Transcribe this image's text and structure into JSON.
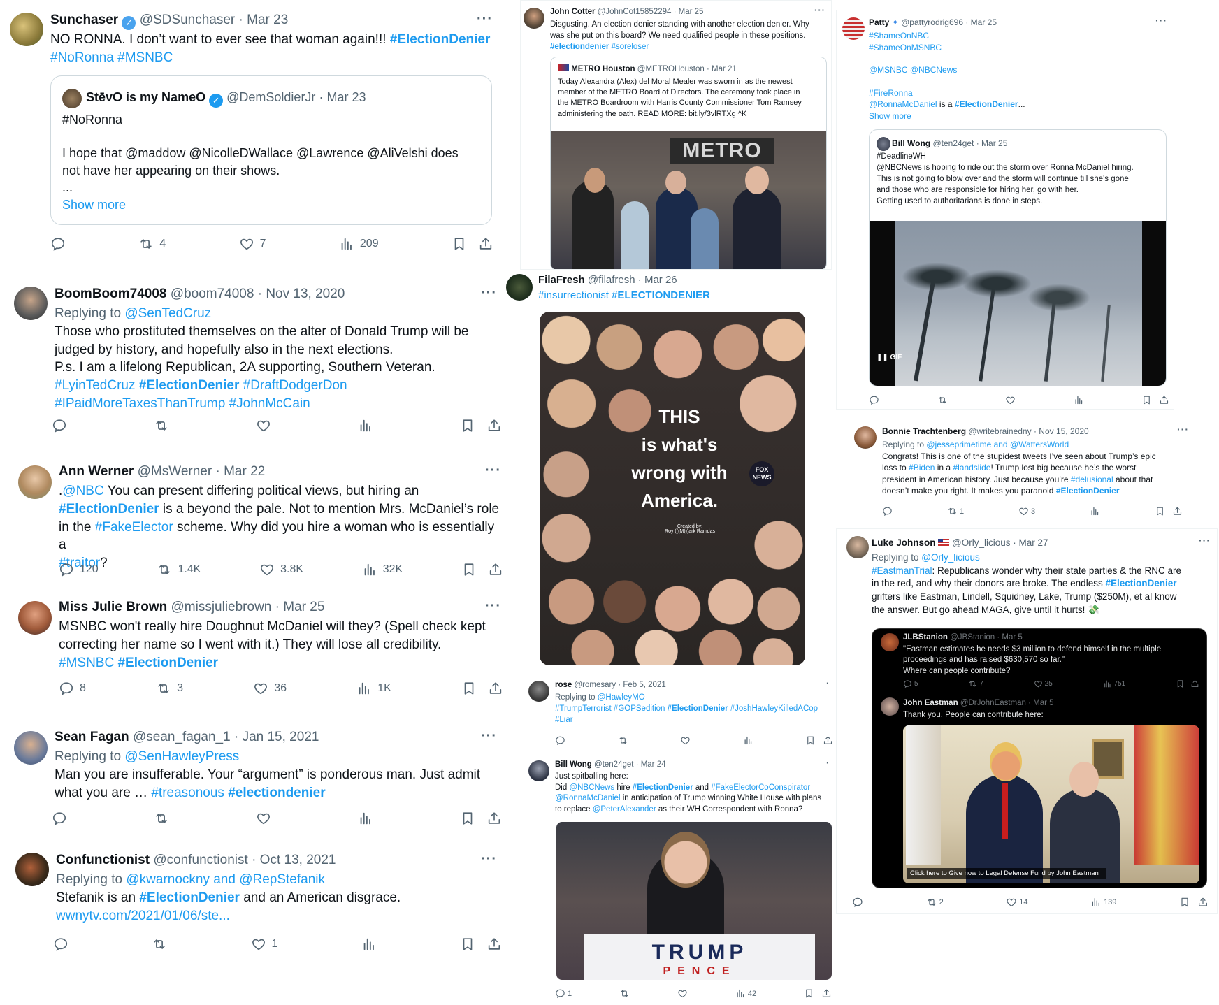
{
  "t1": {
    "name": "Sunchaser",
    "handle": "@SDSunchaser",
    "date": "· Mar 23",
    "text_a": "NO RONNA. I don’t want to ever see that woman again!!! ",
    "tag_a": "#ElectionDenier",
    "tag_b": "#NoRonna #MSNBC",
    "quote": {
      "name": "StēvO is my NameO",
      "handle": "@DemSoldierJr",
      "date": "· Mar 23",
      "line1": "#NoRonna",
      "line2": "I hope that @maddow @NicolleDWallace @Lawrence @AliVelshi  does",
      "line3": "not have her appearing on their shows.",
      "line4": "...",
      "show_more": "Show more"
    },
    "retweets": "4",
    "likes": "7",
    "views": "209"
  },
  "t2": {
    "name": "BoomBoom74008",
    "handle": "@boom74008",
    "date": "· Nov 13, 2020",
    "reply_label": "Replying to ",
    "reply_to": "@SenTedCruz",
    "l1": "Those who prostituted themselves on the alter of Donald Trump will be",
    "l2": "judged by history, and hopefully also in the next elections.",
    "l3": "P.s. I am a lifelong Republican, 2A supporting, Southern Veteran.",
    "tag1": "#LyinTedCruz",
    "tag2": "#ElectionDenier",
    "tag3": "#DraftDodgerDon",
    "tag4": "#IPaidMoreTaxesThanTrump #JohnMcCain"
  },
  "t3": {
    "name": "Ann Werner",
    "handle": "@MsWerner",
    "date": "· Mar 22",
    "l1a": ".",
    "l1b": "@NBC",
    "l1c": " You can present differing political views, but hiring an",
    "l2a": "#ElectionDenier",
    "l2b": " is a beyond the pale. Not to mention Mrs. McDaniel’s role",
    "l3a": "in the ",
    "l3b": "#FakeElector",
    "l3c": " scheme. Why did you hire a woman who is essentially a",
    "l4a": "#traitor",
    "l4b": "?",
    "replies": "120",
    "retweets": "1.4K",
    "likes": "3.8K",
    "views": "32K"
  },
  "t4": {
    "name": "Miss Julie Brown",
    "handle": "@missjuliebrown",
    "date": "· Mar 25",
    "l1": "MSNBC won't really hire Doughnut McDaniel will they? (Spell check kept",
    "l2": "correcting her name so I went with it.) They will lose all credibility.",
    "tag1": "#MSNBC",
    "tag2": "#ElectionDenier",
    "replies": "8",
    "retweets": "3",
    "likes": "36",
    "views": "1K"
  },
  "t5": {
    "name": "Sean Fagan",
    "handle": "@sean_fagan_1",
    "date": "· Jan 15, 2021",
    "reply_label": "Replying to ",
    "reply_to": "@SenHawleyPress",
    "l1": "Man you are insufferable. Your “argument” is ponderous man. Just admit",
    "l2": "what you are … ",
    "tag1": "#treasonous",
    "tag2": "#electiondenier"
  },
  "t6": {
    "name": "Confunctionist",
    "handle": "@confunctionist",
    "date": "· Oct 13, 2021",
    "reply_label": "Replying to ",
    "reply_to": "@kwarnockny and @RepStefanik",
    "l1a": "Stefanik is an ",
    "l1b": "#ElectionDenier",
    "l1c": " and an American disgrace.",
    "link": "wwnytv.com/2021/01/06/ste...",
    "likes": "1"
  },
  "t7": {
    "name": "John Cotter",
    "handle": "@JohnCot15852294",
    "date": "· Mar 25",
    "l1": "Disgusting.  An election denier standing with another election denier.  Why",
    "l2": "was she put on this board?  We need qualified people in these positions.",
    "tag1": "#electiondenier",
    "tag2": "#soreloser",
    "quote": {
      "name": "METRO Houston",
      "handle": "@METROHouston",
      "date": "· Mar 21",
      "l1": "Today Alexandra (Alex) del Moral Mealer was sworn in as the newest",
      "l2": "member of the METRO Board of Directors. The ceremony took place in",
      "l3": "the METRO Boardroom with Harris County Commissioner Tom Ramsey",
      "l4": "administering the oath. READ MORE: bit.ly/3vlRTXg ^K",
      "sign": "METRO"
    }
  },
  "t8": {
    "name": "FilaFresh",
    "handle": "@filafresh",
    "date": "· Mar 26",
    "tag1": "#insurrectionist",
    "tag2": "#ELECTIONDENIER",
    "poster_l1": "THIS",
    "poster_l2": "is what's",
    "poster_l3": "wrong with",
    "poster_l4": "America.",
    "poster_credit_1": "Created by:",
    "poster_credit_2": "Roy (((M)))ark Ramdas",
    "fox": "FOX NEWS"
  },
  "t9": {
    "name": "rose",
    "handle": "@romesary",
    "date": "· Feb 5, 2021",
    "reply_label": "Replying to ",
    "reply_to": "@HawleyMO",
    "tags_a": "#TrumpTerrorist #GOPSedition ",
    "tags_b": "#ElectionDenier",
    "tags_c": " #JoshHawleyKilledACop",
    "tags_d": "#Liar"
  },
  "t10": {
    "name": "Bill Wong",
    "handle": "@ten24get",
    "date": "· Mar 24",
    "l1": "Just spitballing here:",
    "l2a": "Did ",
    "l2b": "@NBCNews",
    "l2c": " hire ",
    "l2d": "#ElectionDenier",
    "l2e": " and ",
    "l2f": "#FakeElectorCoConspirator",
    "l3a": "@RonnaMcDaniel",
    "l3b": " in anticipation of Trump winning White House with plans",
    "l4a": "to replace ",
    "l4b": "@PeterAlexander",
    "l4c": " as their WH Correspondent with Ronna?",
    "podium_1": "TRUMP",
    "podium_2": "PENCE",
    "replies": "1",
    "views": "42"
  },
  "t11": {
    "name": "Patty",
    "handle": "@pattyrodrig696",
    "date": "· Mar 25",
    "l1": "#ShameOnNBC",
    "l2": "#ShameOnMSNBC",
    "l3": "@MSNBC @NBCNews",
    "l4": "#FireRonna",
    "l5a": "@RonnaMcDaniel",
    "l5b": " is a ",
    "l5c": "#ElectionDenier",
    "l5d": "...",
    "show_more": "Show more",
    "quote": {
      "name": "Bill Wong",
      "handle": "@ten24get",
      "date": "· Mar 25",
      "l1": "#DeadlineWH",
      "l2": "@NBCNews is hoping to ride out the storm over Ronna McDaniel hiring.",
      "l3": "This is not going to blow over and the storm will continue till she's gone",
      "l4": "and those who are responsible for hiring her, go with her.",
      "l5": "Getting used to authoritarians is done in steps.",
      "gif": "GIF"
    }
  },
  "t12": {
    "name": "Bonnie Trachtenberg",
    "handle": "@writebrainedny",
    "date": "· Nov 15, 2020",
    "reply_label": "Replying to ",
    "reply_to": "@jesseprimetime and @WattersWorld",
    "l1": "Congrats! This is one of the stupidest tweets I’ve seen about Trump’s epic",
    "l2a": "loss to ",
    "l2b": "#Biden",
    "l2c": " in a ",
    "l2d": "#landslide",
    "l2e": "! Trump lost big because he’s the worst",
    "l3a": "president in American history. Just because you’re ",
    "l3b": "#delusional",
    "l3c": " about that",
    "l4a": "doesn’t make you right. It makes you paranoid ",
    "l4b": "#ElectionDenier",
    "retweets": "1",
    "likes": "3"
  },
  "t13": {
    "name": "Luke Johnson",
    "handle": "@Orly_licious",
    "date": "· Mar 27",
    "reply_label": "Replying to ",
    "reply_to": "@Orly_licious",
    "l1a": "#EastmanTrial",
    "l1b": ": Republicans wonder why their state parties & the RNC are",
    "l2a": "in the red, and why their donors are broke. The endless ",
    "l2b": "#ElectionDenier",
    "l3": "grifters like Eastman, Lindell, Squidney, Lake, Trump ($250M), et al know",
    "l4": "the answer. But go ahead MAGA, give until it hurts! 💸",
    "quote": {
      "name": "JLBStanion",
      "handle": "@JBStanion · Mar 5",
      "l1": "\"Eastman estimates he needs $3 million to defend himself in the multiple",
      "l2": "proceedings and has raised $630,570 so far.\"",
      "l3": "Where can people contribute?",
      "replies": "5",
      "retweets": "7",
      "likes": "25",
      "views": "751",
      "reply_name": "John Eastman",
      "reply_handle": "@DrJohnEastman · Mar 5",
      "reply_text": "Thank you.  People can contribute here:",
      "caption": "Click here to Give now to Legal Defense Fund by John Eastman"
    },
    "retweets": "2",
    "likes": "14",
    "views": "139"
  }
}
